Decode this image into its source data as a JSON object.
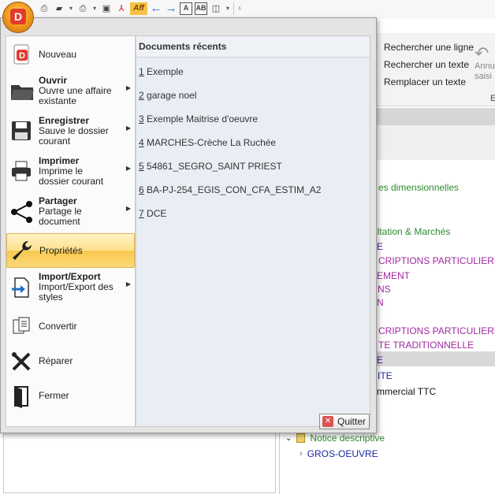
{
  "app_menu": {
    "commands": [
      {
        "id": "nouveau",
        "title": "Nouveau",
        "sub": "",
        "chevron": false,
        "icon": "new-document-icon"
      },
      {
        "id": "ouvrir",
        "title": "Ouvrir",
        "sub": "Ouvre une affaire existante",
        "chevron": true,
        "icon": "folder-open-icon"
      },
      {
        "id": "enregistrer",
        "title": "Enregistrer",
        "sub": "Sauve le dossier courant",
        "chevron": true,
        "icon": "save-icon"
      },
      {
        "id": "imprimer",
        "title": "Imprimer",
        "sub": "Imprime le dossier courant",
        "chevron": true,
        "icon": "printer-icon"
      },
      {
        "id": "partager",
        "title": "Partager",
        "sub": "Partage le document",
        "chevron": true,
        "icon": "share-icon"
      },
      {
        "id": "proprietes",
        "title": "Propriétés",
        "sub": "",
        "chevron": false,
        "icon": "wrench-icon",
        "selected": true
      },
      {
        "id": "import-export",
        "title": "Import/Export",
        "sub": "Import/Export des styles",
        "chevron": true,
        "icon": "import-export-icon"
      },
      {
        "id": "convertir",
        "title": "Convertir",
        "sub": "",
        "chevron": false,
        "icon": "convert-icon"
      },
      {
        "id": "reparer",
        "title": "Réparer",
        "sub": "",
        "chevron": false,
        "icon": "tools-icon"
      },
      {
        "id": "fermer",
        "title": "Fermer",
        "sub": "",
        "chevron": false,
        "icon": "door-exit-icon"
      }
    ],
    "recent_header": "Documents récents",
    "recent": [
      {
        "num": "1",
        "name": "Exemple"
      },
      {
        "num": "2",
        "name": "garage noel"
      },
      {
        "num": "3",
        "name": "Exemple Maitrise d'oeuvre"
      },
      {
        "num": "4",
        "name": "MARCHES-Crèche La Ruchée"
      },
      {
        "num": "5",
        "name": "54861_SEGRO_SAINT PRIEST"
      },
      {
        "num": "6",
        "name": "BA-PJ-254_EGIS_CON_CFA_ESTIM_A2"
      },
      {
        "num": "7",
        "name": "DCE"
      }
    ],
    "quit_label": "Quitter"
  },
  "ribbon": {
    "search_line": "Rechercher une ligne",
    "search_text": "Rechercher un texte",
    "replace_text": "Remplacer un texte",
    "undo_partial": "Annu saisi",
    "group_partial": "E"
  },
  "document_lines": [
    {
      "text": "es dimensionnelles",
      "color": "#2e8b2e"
    },
    {
      "text": "sultation & Marchés",
      "color": "#2e8b2e"
    },
    {
      "text": "E",
      "color": "#5b1a9a"
    },
    {
      "text": "CRIPTIONS  PARTICULIERE",
      "color": "#a02aa0"
    },
    {
      "text": "EMENT",
      "color": "#a02aa0"
    },
    {
      "text": "NS",
      "color": "#a02aa0"
    },
    {
      "text": "N",
      "color": "#a02aa0"
    },
    {
      "text": "CRIPTIONS  PARTICULIERE",
      "color": "#a02aa0"
    },
    {
      "text": "TE TRADITIONNELLE",
      "color": "#a02aa0"
    },
    {
      "text": "E",
      "color": "#5b1a9a"
    },
    {
      "text": "ITE",
      "color": "#1c2aa0"
    },
    {
      "text": "mmercial TTC",
      "color": "#111111"
    }
  ],
  "tree": [
    {
      "text": "Notice descriptive",
      "color": "#2e8b2e",
      "icon": "doc-icon",
      "chevron": "down"
    },
    {
      "text": "GROS-OEUVRE",
      "color": "#1c2aa0",
      "icon": "",
      "chevron": "right"
    }
  ]
}
